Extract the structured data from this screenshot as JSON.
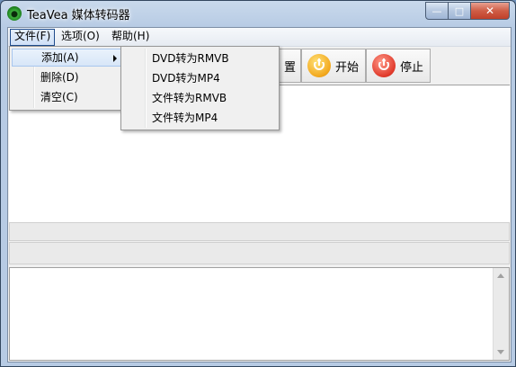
{
  "window": {
    "title": "TeaVea 媒体转码器",
    "min_glyph": "—",
    "max_glyph": "□",
    "close_glyph": "✕"
  },
  "menubar": {
    "file": "文件(F)",
    "options": "选项(O)",
    "help": "帮助(H)"
  },
  "file_menu": {
    "add": "添加(A)",
    "delete": "删除(D)",
    "clear": "清空(C)"
  },
  "add_submenu": [
    "DVD转为RMVB",
    "DVD转为MP4",
    "文件转为RMVB",
    "文件转为MP4"
  ],
  "toolbar": {
    "settings_partial": "置",
    "start": "开始",
    "stop": "停止"
  },
  "colors": {
    "start_icon": "#f2a71c",
    "stop_icon": "#e0392a",
    "menu_highlight": "#d8e6f8"
  },
  "icons": {
    "app": "teavea-logo-icon",
    "start": "power-icon",
    "stop": "power-icon",
    "submenu": "chevron-right-icon"
  }
}
